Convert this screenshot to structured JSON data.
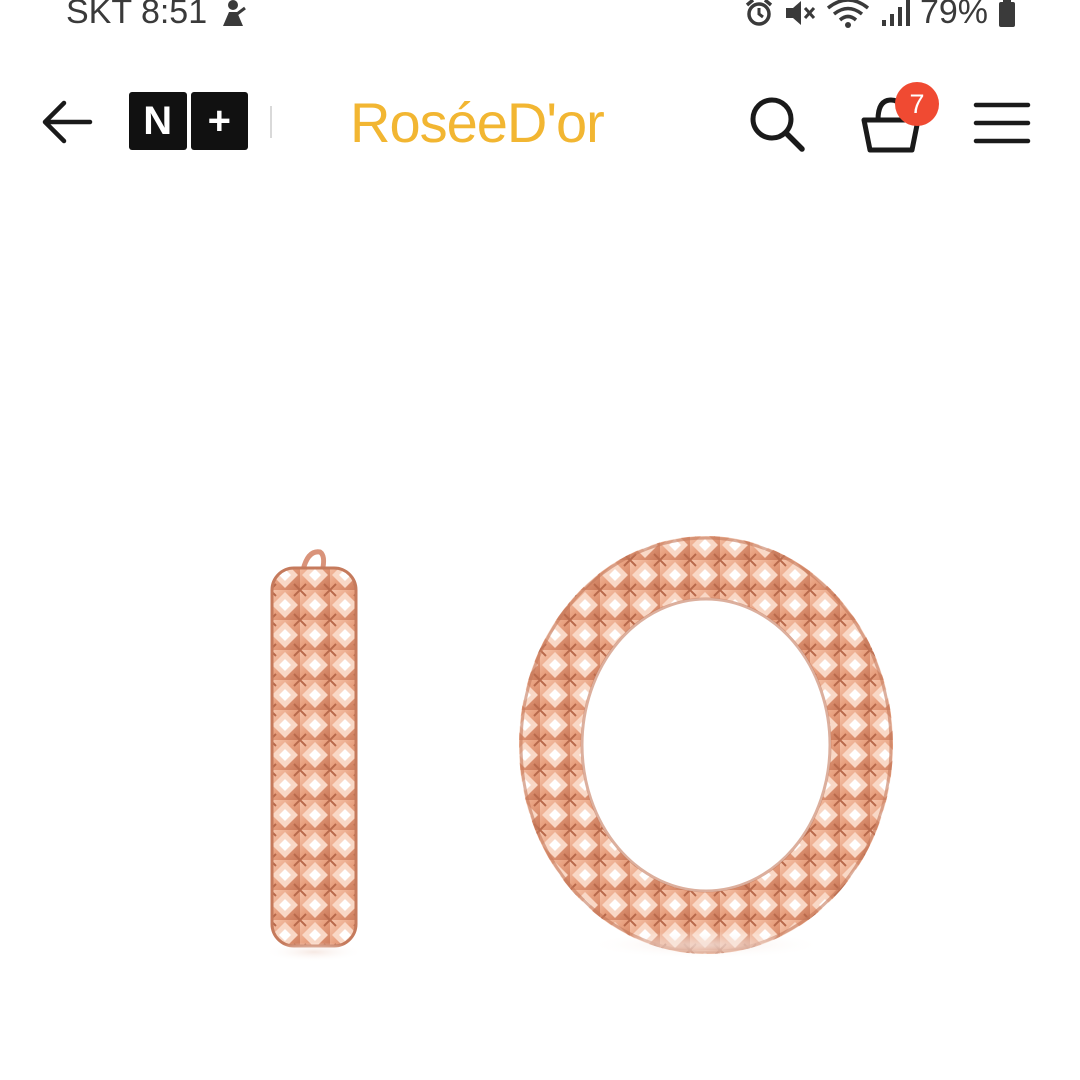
{
  "status_bar": {
    "carrier_time": "SKT 8:51",
    "battery": "79%",
    "icons": [
      "notification-person-icon",
      "alarm-icon",
      "mute-icon",
      "wifi-icon",
      "signal-icon",
      "battery-icon"
    ]
  },
  "header": {
    "back_icon": "arrow-left-icon",
    "badge_left": "N",
    "badge_right": "+",
    "brand": "RoséeD'or",
    "search_icon": "search-icon",
    "cart_icon": "shopping-basket-icon",
    "cart_count": "7",
    "menu_icon": "hamburger-menu-icon"
  },
  "product": {
    "image": "rose-gold-hoop-earrings",
    "metal_color": "#e8a07f"
  },
  "colors": {
    "brand": "#f2b632",
    "badge": "#f04a32",
    "icon": "#1a1a1a"
  }
}
